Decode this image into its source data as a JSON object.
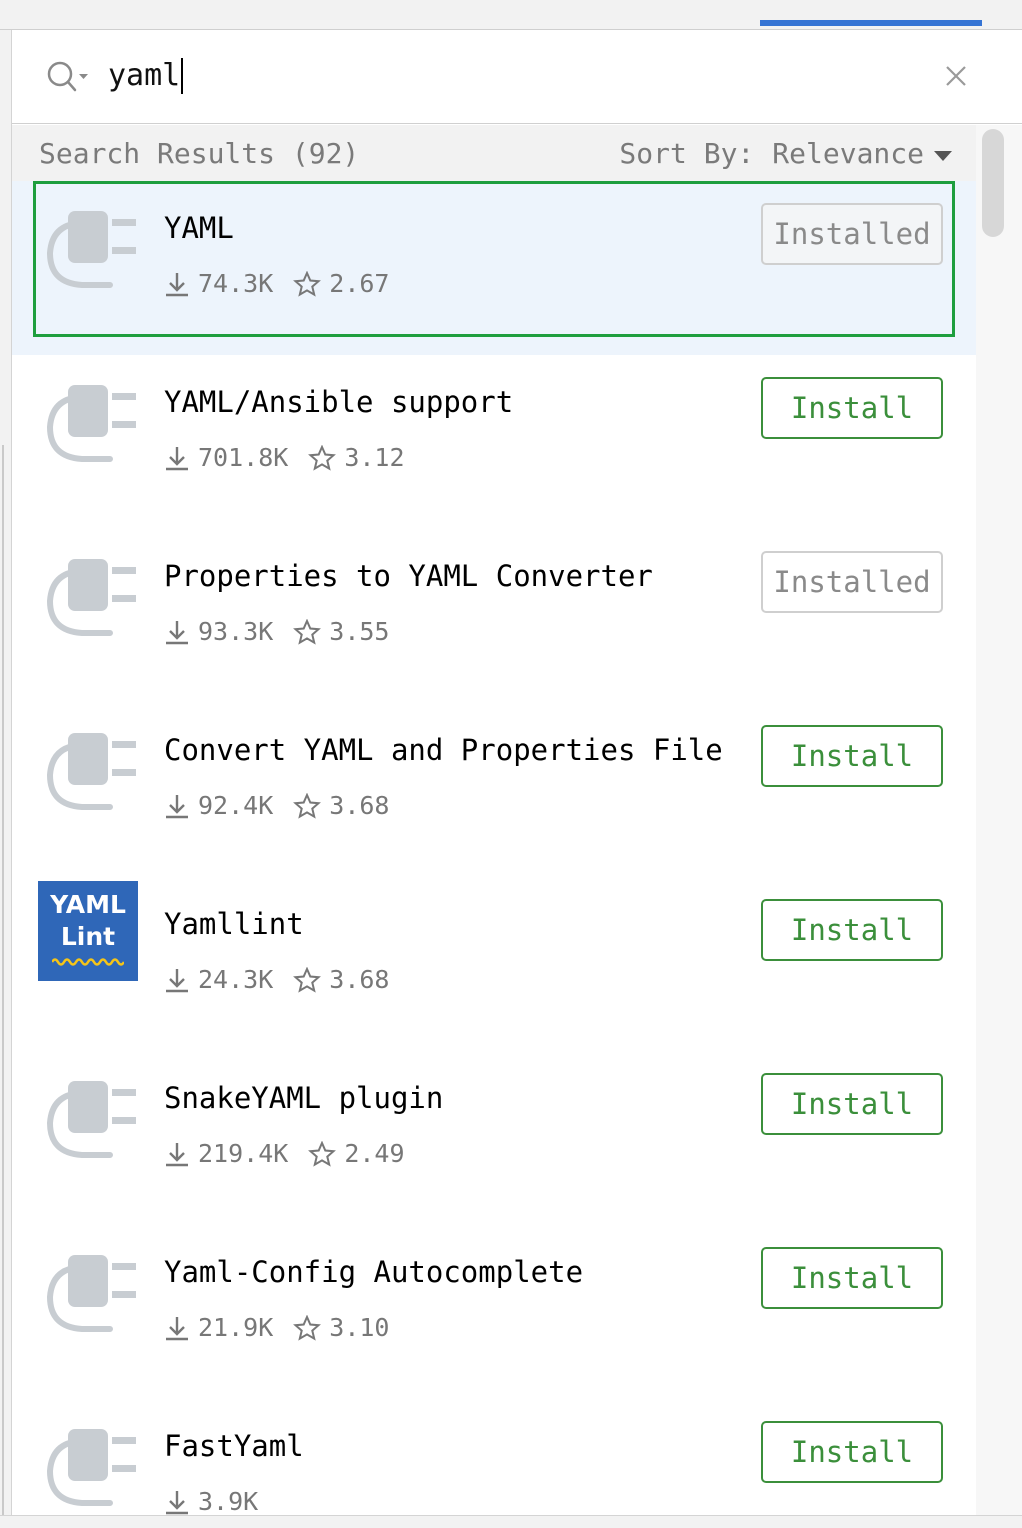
{
  "search": {
    "query": "yaml"
  },
  "results": {
    "count_label": "Search Results (92)",
    "sort_label": "Sort By:",
    "sort_value": "Relevance"
  },
  "colors": {
    "accent_blue": "#3574d4",
    "install_green": "#3b8f3b",
    "selection_border": "#1e9e3e",
    "selection_bg": "#edf4fc"
  },
  "plugins": [
    {
      "name": "YAML",
      "downloads": "74.3K",
      "rating": "2.67",
      "action": "Installed",
      "icon": "plug-icon",
      "selected": true
    },
    {
      "name": "YAML/Ansible support",
      "downloads": "701.8K",
      "rating": "3.12",
      "action": "Install",
      "icon": "plug-icon"
    },
    {
      "name": "Properties to YAML Converter",
      "downloads": "93.3K",
      "rating": "3.55",
      "action": "Installed",
      "icon": "plug-icon"
    },
    {
      "name": "Convert YAML and Properties File",
      "downloads": "92.4K",
      "rating": "3.68",
      "action": "Install",
      "icon": "plug-icon"
    },
    {
      "name": "Yamllint",
      "downloads": "24.3K",
      "rating": "3.68",
      "action": "Install",
      "icon": "yaml-lint-logo",
      "logo_line1": "YAML",
      "logo_line2": "Lint"
    },
    {
      "name": "SnakeYAML plugin",
      "downloads": "219.4K",
      "rating": "2.49",
      "action": "Install",
      "icon": "plug-icon"
    },
    {
      "name": "Yaml-Config Autocomplete",
      "downloads": "21.9K",
      "rating": "3.10",
      "action": "Install",
      "icon": "plug-icon"
    },
    {
      "name": "FastYaml",
      "downloads": "3.9K",
      "action": "Install",
      "icon": "plug-icon"
    }
  ]
}
